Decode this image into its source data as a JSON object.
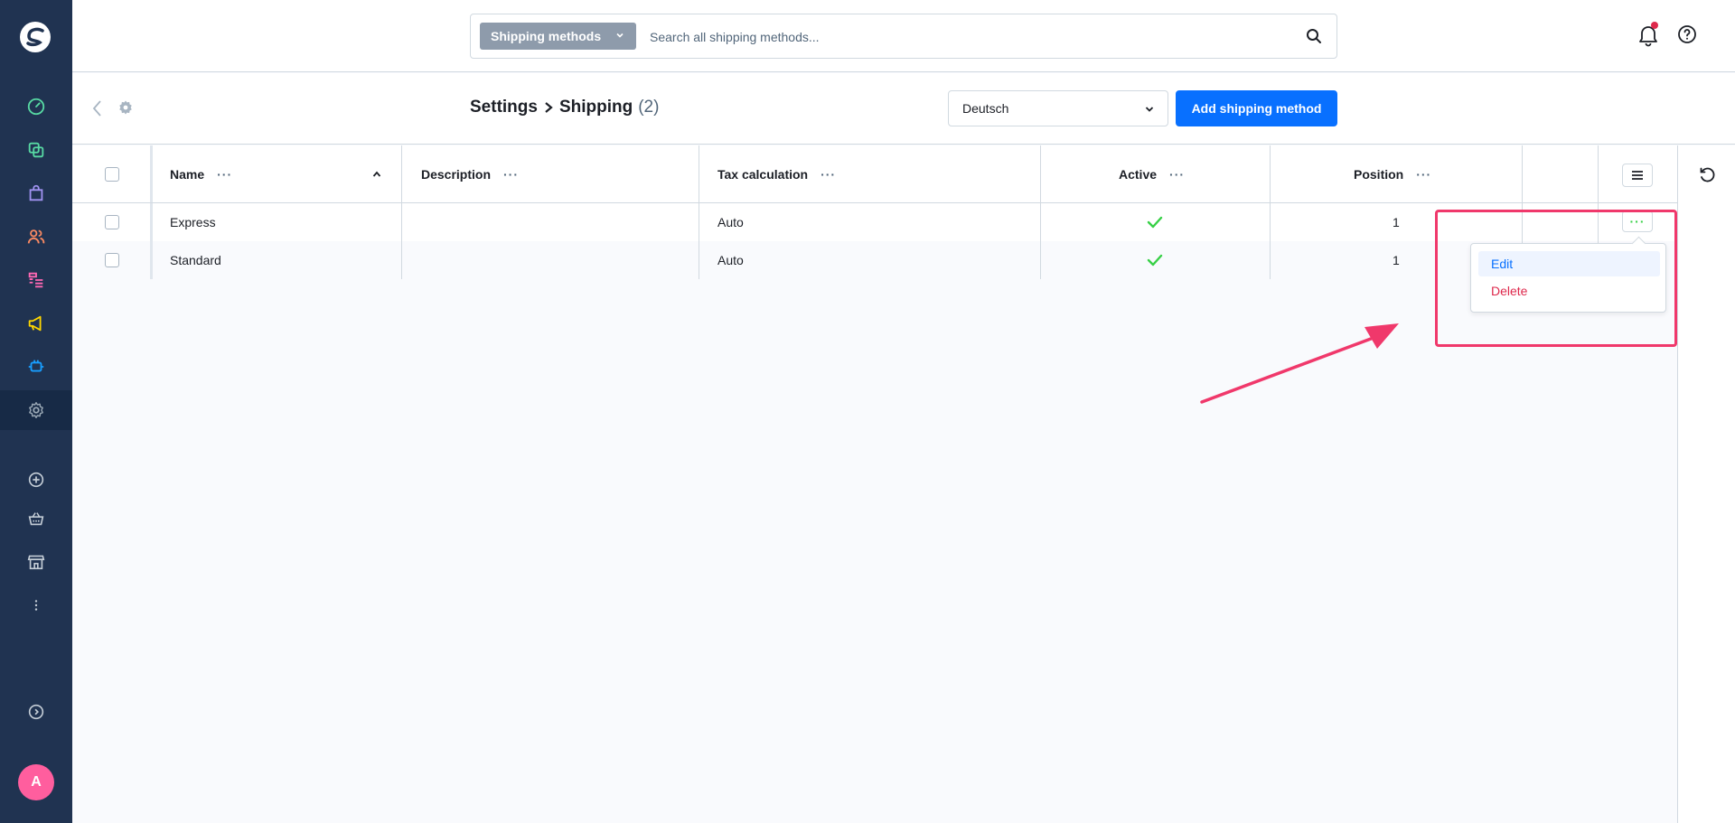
{
  "sidebar": {
    "logo_icon": "shopware-logo-icon",
    "items": [
      {
        "icon": "dashboard-icon",
        "color": "#57d9a3"
      },
      {
        "icon": "catalogue-icon",
        "color": "#57d9a3"
      },
      {
        "icon": "orders-icon",
        "color": "#a092f0"
      },
      {
        "icon": "customers-icon",
        "color": "#f88962"
      },
      {
        "icon": "content-icon",
        "color": "#ff68b4"
      },
      {
        "icon": "marketing-icon",
        "color": "#ffd700"
      },
      {
        "icon": "extensions-icon",
        "color": "#189eff"
      },
      {
        "icon": "settings-icon",
        "color": "#9aa8b5"
      }
    ],
    "avatar_initial": "A",
    "avatar_color": "#ff5e9e"
  },
  "topbar": {
    "search_type": "Shipping methods",
    "search_placeholder": "Search all shipping methods..."
  },
  "header": {
    "breadcrumb_parent": "Settings",
    "breadcrumb_current": "Shipping",
    "count": "(2)",
    "language": "Deutsch",
    "add_button": "Add shipping method"
  },
  "grid": {
    "columns": [
      "Name",
      "Description",
      "Tax calculation",
      "Active",
      "Position"
    ],
    "rows": [
      {
        "name": "Express",
        "description": "",
        "tax": "Auto",
        "active": true,
        "position": "1"
      },
      {
        "name": "Standard",
        "description": "",
        "tax": "Auto",
        "active": true,
        "position": "1"
      }
    ],
    "row_action_label": "···"
  },
  "context_menu": {
    "edit": "Edit",
    "delete": "Delete"
  },
  "colors": {
    "primary": "#0870ff",
    "danger": "#de294c",
    "success": "#37d046",
    "annotation": "#f0386b"
  }
}
